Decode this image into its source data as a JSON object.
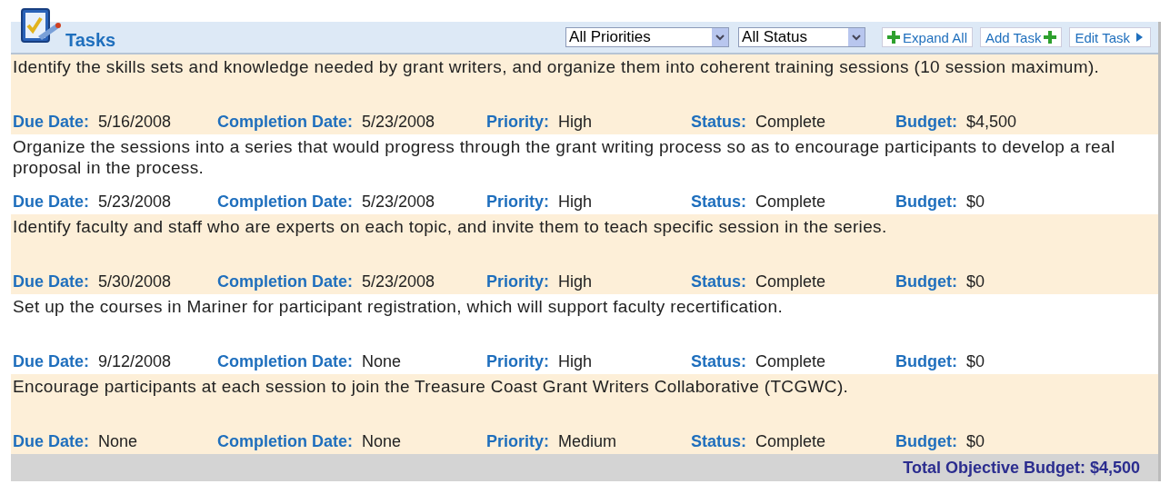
{
  "header": {
    "title": "Tasks",
    "filters": [
      {
        "value": "All Priorities"
      },
      {
        "value": "All Status"
      }
    ],
    "buttons": [
      {
        "kind": "expand",
        "label": "Expand All"
      },
      {
        "kind": "add",
        "label": "Add Task"
      },
      {
        "kind": "edit",
        "label": "Edit Task"
      }
    ]
  },
  "tasks": [
    {
      "description": "Identify the skills sets and knowledge needed by grant writers, and organize them into coherent training sessions (10 session maximum).",
      "fields": [
        {
          "label": "Due Date:",
          "value": "5/16/2008"
        },
        {
          "label": "Completion Date:",
          "value": "5/23/2008"
        },
        {
          "label": "Priority:",
          "value": "High"
        },
        {
          "label": "Status:",
          "value": "Complete"
        },
        {
          "label": "Budget:",
          "value": "$4,500"
        }
      ]
    },
    {
      "description": "Organize the sessions into a series that would progress through the grant writing process so as to encourage participants to develop a real proposal in the process.",
      "fields": [
        {
          "label": "Due Date:",
          "value": "5/23/2008"
        },
        {
          "label": "Completion Date:",
          "value": "5/23/2008"
        },
        {
          "label": "Priority:",
          "value": "High"
        },
        {
          "label": "Status:",
          "value": "Complete"
        },
        {
          "label": "Budget:",
          "value": "$0"
        }
      ]
    },
    {
      "description": "Identify faculty and staff who are experts on each topic, and invite them to teach specific session in the series.",
      "fields": [
        {
          "label": "Due Date:",
          "value": "5/30/2008"
        },
        {
          "label": "Completion Date:",
          "value": "5/23/2008"
        },
        {
          "label": "Priority:",
          "value": "High"
        },
        {
          "label": "Status:",
          "value": "Complete"
        },
        {
          "label": "Budget:",
          "value": "$0"
        }
      ]
    },
    {
      "description": "Set up the courses in Mariner for participant registration, which will support faculty recertification.",
      "fields": [
        {
          "label": "Due Date:",
          "value": "9/12/2008"
        },
        {
          "label": "Completion Date:",
          "value": "None"
        },
        {
          "label": "Priority:",
          "value": "High"
        },
        {
          "label": "Status:",
          "value": "Complete"
        },
        {
          "label": "Budget:",
          "value": "$0"
        }
      ]
    },
    {
      "description": "Encourage participants at each session to join the Treasure Coast Grant Writers Collaborative (TCGWC).",
      "fields": [
        {
          "label": "Due Date:",
          "value": "None"
        },
        {
          "label": "Completion Date:",
          "value": "None"
        },
        {
          "label": "Priority:",
          "value": "Medium"
        },
        {
          "label": "Status:",
          "value": "Complete"
        },
        {
          "label": "Budget:",
          "value": "$0"
        }
      ]
    }
  ],
  "footer": {
    "total": "Total Objective Budget: $4,500"
  }
}
